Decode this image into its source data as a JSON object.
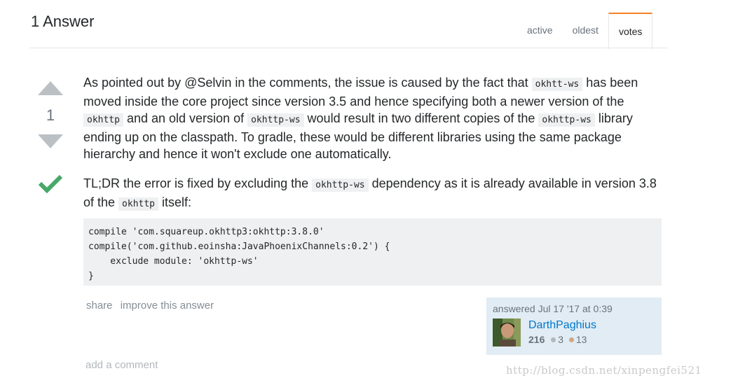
{
  "header": {
    "title": "1 Answer",
    "tabs": [
      {
        "label": "active"
      },
      {
        "label": "oldest"
      },
      {
        "label": "votes"
      }
    ]
  },
  "vote": {
    "count": "1"
  },
  "post": {
    "p1": {
      "t1": "As pointed out by @Selvin in the comments, the issue is caused by the fact that ",
      "c1": "okhtt-ws",
      "t2": " has been moved inside the core project since version 3.5 and hence specifying both a newer version of the ",
      "c2": "okhttp",
      "t3": " and an old version of ",
      "c3": "okhttp-ws",
      "t4": " would result in two different copies of the ",
      "c4": "okhttp-ws",
      "t5": " library ending up on the classpath. To gradle, these would be different libraries using the same package hierarchy and hence it won't exclude one automatically."
    },
    "p2": {
      "t1": "TL;DR the error is fixed by excluding the ",
      "c1": "okhttp-ws",
      "t2": " dependency as it is already available in version 3.8 of the ",
      "c2": "okhttp",
      "t3": " itself:"
    },
    "code": "compile 'com.squareup.okhttp3:okhttp:3.8.0'\ncompile('com.github.eoinsha:JavaPhoenixChannels:0.2') {\n    exclude module: 'okhttp-ws'\n}"
  },
  "menu": {
    "share": "share",
    "improve": "improve this answer"
  },
  "signature": {
    "time": "answered Jul 17 '17 at 0:39",
    "user": "DarthPaghius",
    "reputation": "216",
    "silver": "3",
    "bronze": "13",
    "silver_color": "#b4b8bc",
    "bronze_color": "#d1a684"
  },
  "add_comment": "add a comment",
  "watermark": "http://blog.csdn.net/xinpengfei521",
  "colors": {
    "accent": "#f48024",
    "link": "#0077cc",
    "accepted": "#48a868",
    "vote_arrow": "#bbc0c4"
  }
}
